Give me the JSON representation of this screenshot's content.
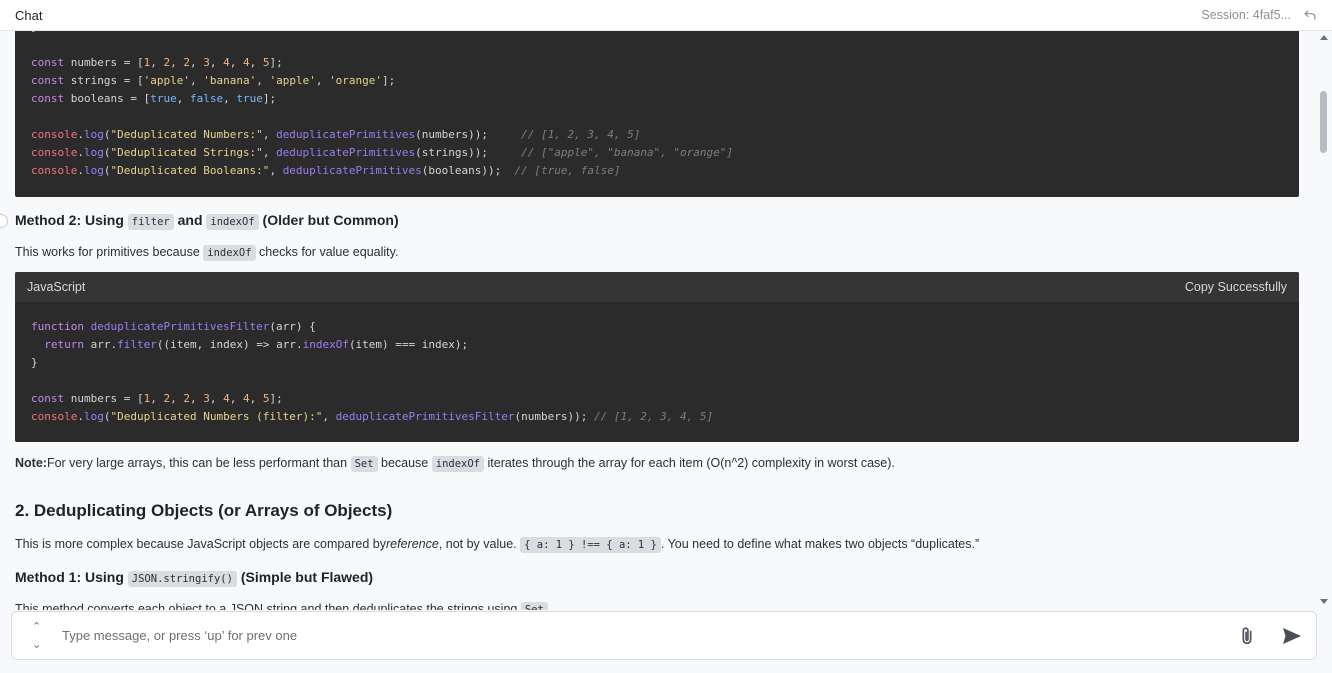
{
  "header": {
    "title": "Chat",
    "session": "Session: 4faf5..."
  },
  "block1": {
    "lines": [
      [
        [
          "plain",
          "}"
        ]
      ],
      [],
      [
        [
          "kw",
          "const"
        ],
        [
          "plain",
          " numbers = ["
        ],
        [
          "num",
          "1"
        ],
        [
          "plain",
          ", "
        ],
        [
          "num",
          "2"
        ],
        [
          "plain",
          ", "
        ],
        [
          "num",
          "2"
        ],
        [
          "plain",
          ", "
        ],
        [
          "num",
          "3"
        ],
        [
          "plain",
          ", "
        ],
        [
          "num",
          "4"
        ],
        [
          "plain",
          ", "
        ],
        [
          "num",
          "4"
        ],
        [
          "plain",
          ", "
        ],
        [
          "num",
          "5"
        ],
        [
          "plain",
          "];"
        ]
      ],
      [
        [
          "kw",
          "const"
        ],
        [
          "plain",
          " strings = ["
        ],
        [
          "str",
          "'apple'"
        ],
        [
          "plain",
          ", "
        ],
        [
          "str",
          "'banana'"
        ],
        [
          "plain",
          ", "
        ],
        [
          "str",
          "'apple'"
        ],
        [
          "plain",
          ", "
        ],
        [
          "str",
          "'orange'"
        ],
        [
          "plain",
          "];"
        ]
      ],
      [
        [
          "kw",
          "const"
        ],
        [
          "plain",
          " booleans = ["
        ],
        [
          "lit",
          "true"
        ],
        [
          "plain",
          ", "
        ],
        [
          "lit",
          "false"
        ],
        [
          "plain",
          ", "
        ],
        [
          "lit",
          "true"
        ],
        [
          "plain",
          "];"
        ]
      ],
      [],
      [
        [
          "con",
          "console"
        ],
        [
          "plain",
          "."
        ],
        [
          "fnc",
          "log"
        ],
        [
          "plain",
          "("
        ],
        [
          "str",
          "\"Deduplicated Numbers:\""
        ],
        [
          "plain",
          ", "
        ],
        [
          "fn",
          "deduplicatePrimitives"
        ],
        [
          "plain",
          "(numbers));     "
        ],
        [
          "cm",
          "// [1, 2, 3, 4, 5]"
        ]
      ],
      [
        [
          "con",
          "console"
        ],
        [
          "plain",
          "."
        ],
        [
          "fnc",
          "log"
        ],
        [
          "plain",
          "("
        ],
        [
          "str",
          "\"Deduplicated Strings:\""
        ],
        [
          "plain",
          ", "
        ],
        [
          "fn",
          "deduplicatePrimitives"
        ],
        [
          "plain",
          "(strings));     "
        ],
        [
          "cm",
          "// [\"apple\", \"banana\", \"orange\"]"
        ]
      ],
      [
        [
          "con",
          "console"
        ],
        [
          "plain",
          "."
        ],
        [
          "fnc",
          "log"
        ],
        [
          "plain",
          "("
        ],
        [
          "str",
          "\"Deduplicated Booleans:\""
        ],
        [
          "plain",
          ", "
        ],
        [
          "fn",
          "deduplicatePrimitives"
        ],
        [
          "plain",
          "(booleans));  "
        ],
        [
          "cm",
          "// [true, false]"
        ]
      ]
    ]
  },
  "method2": {
    "prefix": "Method 2: Using ",
    "code1": "filter",
    "and": " and ",
    "code2": "indexOf",
    "suffix": " (Older but Common)"
  },
  "method2_desc": {
    "prefix": "This works for primitives because ",
    "code": "indexOf",
    "suffix": " checks for value equality."
  },
  "block2": {
    "language": "JavaScript",
    "copy_label": "Copy Successfully",
    "lines": [
      [
        [
          "kw",
          "function"
        ],
        [
          "plain",
          " "
        ],
        [
          "fn",
          "deduplicatePrimitivesFilter"
        ],
        [
          "plain",
          "(arr) {"
        ]
      ],
      [
        [
          "plain",
          "  "
        ],
        [
          "kw",
          "return"
        ],
        [
          "plain",
          " arr."
        ],
        [
          "fnc",
          "filter"
        ],
        [
          "plain",
          "((item, index) => arr."
        ],
        [
          "fnc",
          "indexOf"
        ],
        [
          "plain",
          "(item) === index);"
        ]
      ],
      [
        [
          "plain",
          "}"
        ]
      ],
      [],
      [
        [
          "kw",
          "const"
        ],
        [
          "plain",
          " numbers = ["
        ],
        [
          "num",
          "1"
        ],
        [
          "plain",
          ", "
        ],
        [
          "num",
          "2"
        ],
        [
          "plain",
          ", "
        ],
        [
          "num",
          "2"
        ],
        [
          "plain",
          ", "
        ],
        [
          "num",
          "3"
        ],
        [
          "plain",
          ", "
        ],
        [
          "num",
          "4"
        ],
        [
          "plain",
          ", "
        ],
        [
          "num",
          "4"
        ],
        [
          "plain",
          ", "
        ],
        [
          "num",
          "5"
        ],
        [
          "plain",
          "];"
        ]
      ],
      [
        [
          "con",
          "console"
        ],
        [
          "plain",
          "."
        ],
        [
          "fnc",
          "log"
        ],
        [
          "plain",
          "("
        ],
        [
          "str",
          "\"Deduplicated Numbers (filter):\""
        ],
        [
          "plain",
          ", "
        ],
        [
          "fn",
          "deduplicatePrimitivesFilter"
        ],
        [
          "plain",
          "(numbers)); "
        ],
        [
          "cm",
          "// [1, 2, 3, 4, 5]"
        ]
      ]
    ]
  },
  "note": {
    "label": "Note:",
    "part1": "For very large arrays, this can be less performant than ",
    "code1": "Set",
    "part2": " because ",
    "code2": "indexOf",
    "part3": " iterates through the array for each item (O(n^2) complexity in worst case)."
  },
  "section2_title": "2. Deduplicating Objects (or Arrays of Objects)",
  "section2_desc": {
    "part1": "This is more complex because JavaScript objects are compared by",
    "em": "reference",
    "part2": ", not by value. ",
    "code": "{ a: 1 } !== { a: 1 }",
    "part3": ". You need to define what makes two objects “duplicates.”"
  },
  "method1": {
    "prefix": "Method 1: Using ",
    "code": "JSON.stringify()",
    "suffix": " (Simple but Flawed)"
  },
  "method1_desc": {
    "text": "This method converts each object to a JSON string and then deduplicates the strings using ",
    "code": "Set"
  },
  "composer": {
    "placeholder": "Type message, or press ‘up’ for prev one",
    "hist_up": "⌃",
    "hist_down": "⌄"
  }
}
